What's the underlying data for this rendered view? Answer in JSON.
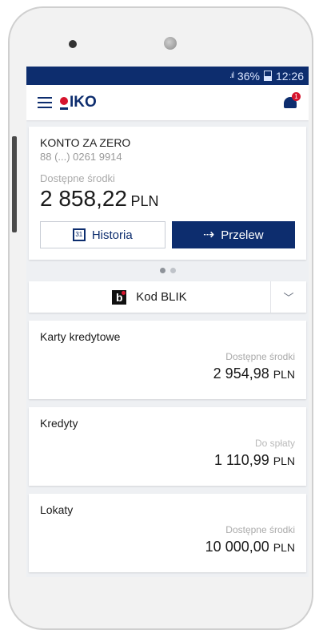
{
  "status_bar": {
    "signal": ".ıl",
    "battery": "36%",
    "time": "12:26"
  },
  "app": {
    "logo_text": "IKO",
    "notification_count": "1"
  },
  "account": {
    "name": "KONTO ZA ZERO",
    "number": "88 (...) 0261 9914",
    "available_label": "Dostępne środki",
    "balance": "2 858,22",
    "currency": "PLN",
    "history_button": "Historia",
    "history_icon_day": "31",
    "transfer_button": "Przelew"
  },
  "blik": {
    "label": "Kod BLIK",
    "icon_letter": "b"
  },
  "products": [
    {
      "title": "Karty kredytowe",
      "sub_label": "Dostępne środki",
      "value": "2 954,98",
      "currency": "PLN"
    },
    {
      "title": "Kredyty",
      "sub_label": "Do spłaty",
      "value": "1 110,99",
      "currency": "PLN"
    },
    {
      "title": "Lokaty",
      "sub_label": "Dostępne środki",
      "value": "10 000,00",
      "currency": "PLN"
    }
  ],
  "colors": {
    "navy": "#0d2d6e",
    "red": "#d6142d"
  }
}
